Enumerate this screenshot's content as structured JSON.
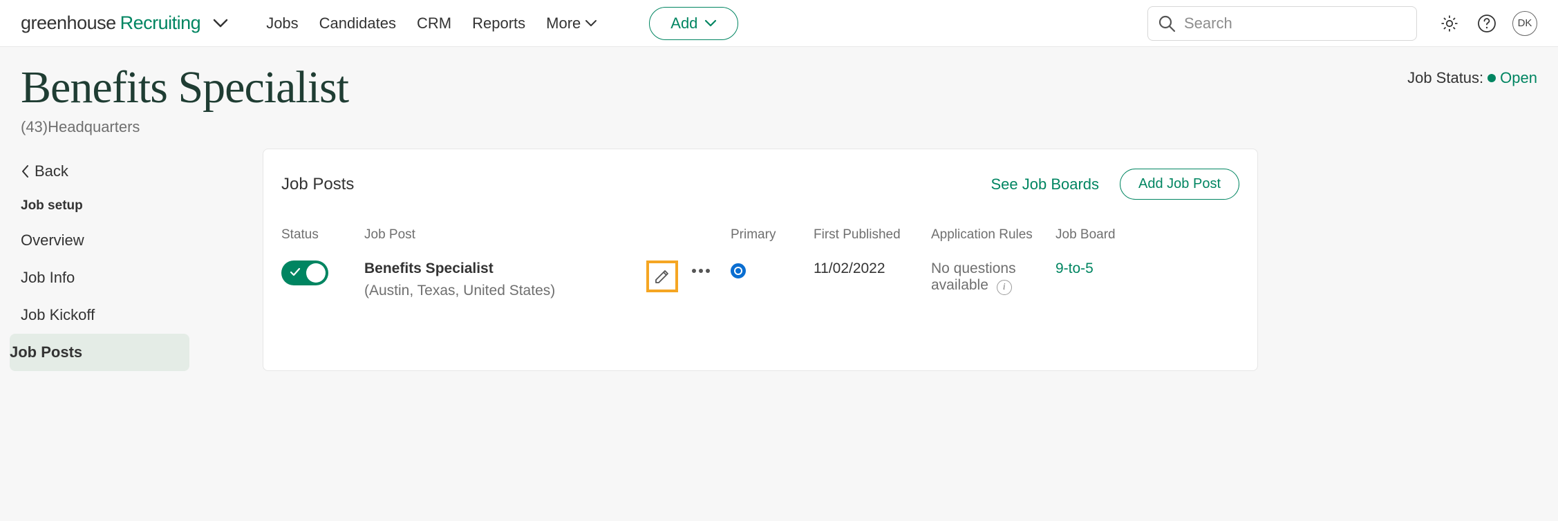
{
  "brand": {
    "part1": "greenhouse",
    "part2": "Recruiting"
  },
  "nav": {
    "jobs": "Jobs",
    "candidates": "Candidates",
    "crm": "CRM",
    "reports": "Reports",
    "more": "More"
  },
  "add_button": "Add",
  "search": {
    "placeholder": "Search"
  },
  "avatar_initials": "DK",
  "page": {
    "title": "Benefits Specialist",
    "subtitle_reqs": "(43)",
    "subtitle_loc": "Headquarters",
    "status_label": "Job Status:",
    "status_value": "Open"
  },
  "sidebar": {
    "back": "Back",
    "heading": "Job setup",
    "items": [
      {
        "label": "Overview"
      },
      {
        "label": "Job Info"
      },
      {
        "label": "Job Kickoff"
      },
      {
        "label": "Job Posts",
        "active": true
      }
    ]
  },
  "panel": {
    "title": "Job Posts",
    "see_boards": "See Job Boards",
    "add_post": "Add Job Post",
    "columns": {
      "status": "Status",
      "post": "Job Post",
      "primary": "Primary",
      "first_published": "First Published",
      "rules": "Application Rules",
      "board": "Job Board"
    },
    "rows": [
      {
        "name": "Benefits Specialist",
        "location": "(Austin, Texas, United States)",
        "first_published": "11/02/2022",
        "rules_line1": "No questions",
        "rules_line2": "available",
        "board": "9-to-5"
      }
    ]
  }
}
